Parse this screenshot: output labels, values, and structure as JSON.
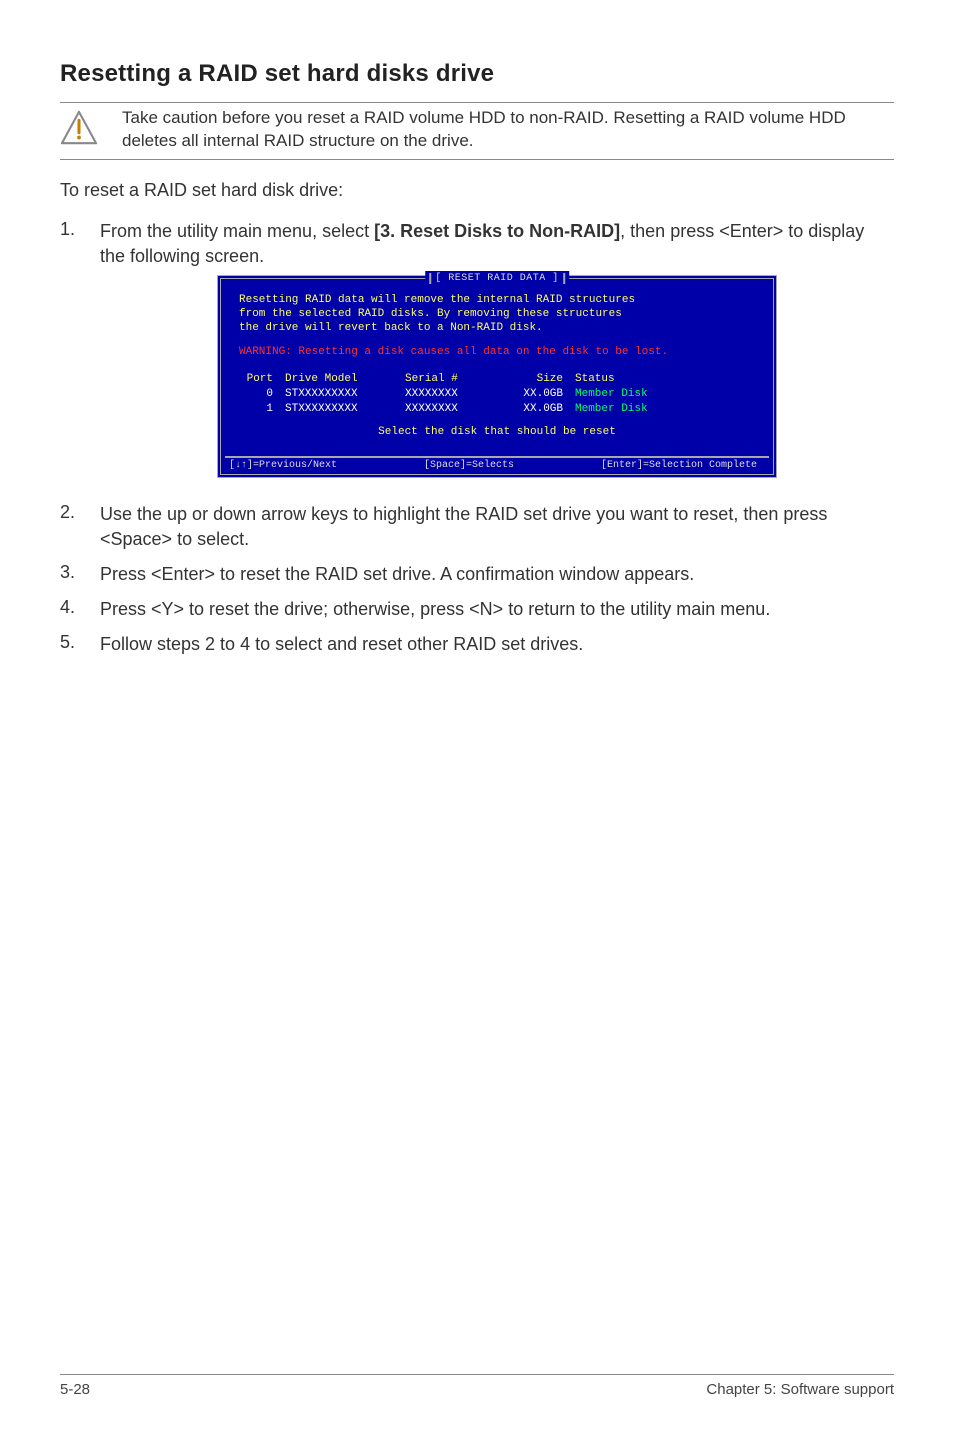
{
  "heading": "Resetting a RAID set hard disks drive",
  "caution": "Take caution before you reset a RAID volume HDD to non-RAID. Resetting a RAID volume HDD deletes all internal RAID structure on the drive.",
  "intro": "To reset a RAID set hard disk drive:",
  "steps": {
    "s1": {
      "num": "1.",
      "pre": "From the utility main menu, select ",
      "bold": "[3. Reset Disks to Non-RAID]",
      "post": ", then press <Enter> to display the following screen."
    },
    "s2": {
      "num": "2.",
      "text": "Use the up or down arrow keys to highlight the RAID set drive you want to reset, then press <Space> to select."
    },
    "s3": {
      "num": "3.",
      "text": "Press <Enter> to reset the RAID set drive. A confirmation window appears."
    },
    "s4": {
      "num": "4.",
      "text": "Press <Y> to reset the drive; otherwise, press <N> to return to the utility main menu."
    },
    "s5": {
      "num": "5.",
      "text": "Follow steps 2 to 4 to select and reset other RAID set drives."
    }
  },
  "bios": {
    "title": "[ RESET RAID DATA ]",
    "para": "Resetting RAID data will remove the internal RAID structures\nfrom the selected RAID disks. By removing these structures\nthe drive will revert back to a Non-RAID disk.",
    "warning": "WARNING: Resetting a disk causes all data on the disk to be lost.",
    "headers": {
      "port": "Port",
      "model": "Drive Model",
      "serial": "Serial #",
      "size": "Size",
      "status": "Status"
    },
    "rows": [
      {
        "port": "0",
        "model": "STXXXXXXXXX",
        "serial": "XXXXXXXX",
        "size": "XX.0GB",
        "status": "Member Disk"
      },
      {
        "port": "1",
        "model": "STXXXXXXXXX",
        "serial": "XXXXXXXX",
        "size": "XX.0GB",
        "status": "Member Disk"
      }
    ],
    "select_line": "Select the disk that should be reset",
    "footer_left": "[↓↑]=Previous/Next",
    "footer_mid": "[Space]=Selects",
    "footer_right": "[Enter]=Selection Complete"
  },
  "footer": {
    "left": "5-28",
    "right": "Chapter 5: Software support"
  }
}
